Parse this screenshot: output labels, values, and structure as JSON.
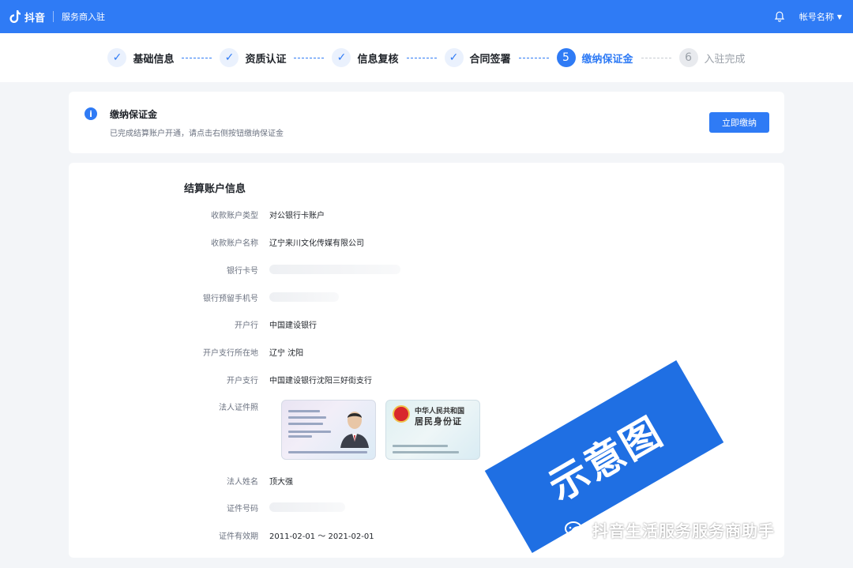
{
  "topbar": {
    "logo_text": "抖音",
    "system_title": "服务商入驻",
    "account_name": "帐号名称"
  },
  "steps": [
    {
      "label": "基础信息",
      "state": "done",
      "symbol": "✓"
    },
    {
      "label": "资质认证",
      "state": "done",
      "symbol": "✓"
    },
    {
      "label": "信息复核",
      "state": "done",
      "symbol": "✓"
    },
    {
      "label": "合同签署",
      "state": "done",
      "symbol": "✓"
    },
    {
      "label": "缴纳保证金",
      "state": "active",
      "symbol": "5"
    },
    {
      "label": "入驻完成",
      "state": "todo",
      "symbol": "6"
    }
  ],
  "notice": {
    "icon": "i",
    "title": "缴纳保证金",
    "description": "已完成结算账户开通，请点击右侧按钮缴纳保证金",
    "button_label": "立即缴纳"
  },
  "account": {
    "section_title": "结算账户信息",
    "fields": [
      {
        "label": "收款账户类型",
        "value": "对公银行卡账户"
      },
      {
        "label": "收款账户名称",
        "value": "辽宁来川文化传媒有限公司"
      },
      {
        "label": "银行卡号",
        "value": ""
      },
      {
        "label": "银行预留手机号",
        "value": ""
      },
      {
        "label": "开户行",
        "value": "中国建设银行"
      },
      {
        "label": "开户支行所在地",
        "value": "辽宁 沈阳"
      },
      {
        "label": "开户支行",
        "value": "中国建设银行沈阳三好街支行"
      },
      {
        "label": "法人证件照",
        "value": ""
      },
      {
        "label": "法人姓名",
        "value": "顶大强"
      },
      {
        "label": "证件号码",
        "value": ""
      },
      {
        "label": "证件有效期",
        "value": "2011-02-01 ～ 2021-02-01"
      }
    ]
  },
  "id_card_back": {
    "line1": "中华人民共和国",
    "line2": "居民身份证"
  },
  "watermark": {
    "stamp_text": "示意图",
    "channel_text": "抖音生活服务服务商助手"
  },
  "colors": {
    "primary": "#2f7bf5",
    "stamp": "#1f6fe3"
  }
}
